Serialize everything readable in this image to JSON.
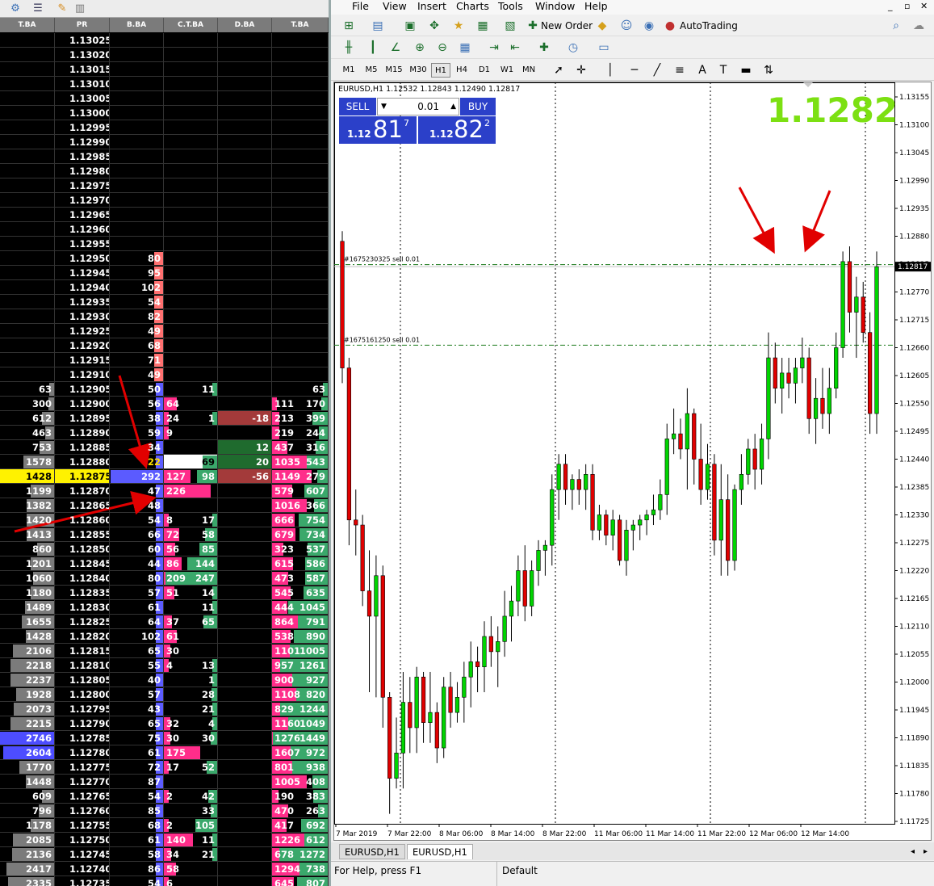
{
  "dom": {
    "toolbar_icons": [
      "gear-icon",
      "list-icon",
      "pencil-icon",
      "trash-icon"
    ],
    "columns": [
      "T.BA",
      "PR",
      "B.BA",
      "C.T.BA",
      "D.BA",
      "T.BA"
    ],
    "rows": [
      {
        "ta": "",
        "pr": "1.13025",
        "bb": "",
        "ctl": "",
        "ctr": "",
        "db": "",
        "tl": "",
        "tr": ""
      },
      {
        "ta": "",
        "pr": "1.13020",
        "bb": "",
        "ctl": "",
        "ctr": "",
        "db": "",
        "tl": "",
        "tr": ""
      },
      {
        "ta": "",
        "pr": "1.13015",
        "bb": "",
        "ctl": "",
        "ctr": "",
        "db": "",
        "tl": "",
        "tr": ""
      },
      {
        "ta": "",
        "pr": "1.13010",
        "bb": "",
        "ctl": "",
        "ctr": "",
        "db": "",
        "tl": "",
        "tr": ""
      },
      {
        "ta": "",
        "pr": "1.13005",
        "bb": "",
        "ctl": "",
        "ctr": "",
        "db": "",
        "tl": "",
        "tr": ""
      },
      {
        "ta": "",
        "pr": "1.13000",
        "bb": "",
        "ctl": "",
        "ctr": "",
        "db": "",
        "tl": "",
        "tr": ""
      },
      {
        "ta": "",
        "pr": "1.12995",
        "bb": "",
        "ctl": "",
        "ctr": "",
        "db": "",
        "tl": "",
        "tr": ""
      },
      {
        "ta": "",
        "pr": "1.12990",
        "bb": "",
        "ctl": "",
        "ctr": "",
        "db": "",
        "tl": "",
        "tr": ""
      },
      {
        "ta": "",
        "pr": "1.12985",
        "bb": "",
        "ctl": "",
        "ctr": "",
        "db": "",
        "tl": "",
        "tr": ""
      },
      {
        "ta": "",
        "pr": "1.12980",
        "bb": "",
        "ctl": "",
        "ctr": "",
        "db": "",
        "tl": "",
        "tr": ""
      },
      {
        "ta": "",
        "pr": "1.12975",
        "bb": "",
        "ctl": "",
        "ctr": "",
        "db": "",
        "tl": "",
        "tr": ""
      },
      {
        "ta": "",
        "pr": "1.12970",
        "bb": "",
        "ctl": "",
        "ctr": "",
        "db": "",
        "tl": "",
        "tr": ""
      },
      {
        "ta": "",
        "pr": "1.12965",
        "bb": "",
        "ctl": "",
        "ctr": "",
        "db": "",
        "tl": "",
        "tr": ""
      },
      {
        "ta": "",
        "pr": "1.12960",
        "bb": "",
        "ctl": "",
        "ctr": "",
        "db": "",
        "tl": "",
        "tr": ""
      },
      {
        "ta": "",
        "pr": "1.12955",
        "bb": "",
        "ctl": "",
        "ctr": "",
        "db": "",
        "tl": "",
        "tr": ""
      },
      {
        "ta": "",
        "pr": "1.12950",
        "bb": "80",
        "ctl": "",
        "ctr": "",
        "db": "",
        "tl": "",
        "tr": ""
      },
      {
        "ta": "",
        "pr": "1.12945",
        "bb": "95",
        "ctl": "",
        "ctr": "",
        "db": "",
        "tl": "",
        "tr": ""
      },
      {
        "ta": "",
        "pr": "1.12940",
        "bb": "102",
        "ctl": "",
        "ctr": "",
        "db": "",
        "tl": "",
        "tr": ""
      },
      {
        "ta": "",
        "pr": "1.12935",
        "bb": "54",
        "ctl": "",
        "ctr": "",
        "db": "",
        "tl": "",
        "tr": ""
      },
      {
        "ta": "",
        "pr": "1.12930",
        "bb": "82",
        "ctl": "",
        "ctr": "",
        "db": "",
        "tl": "",
        "tr": ""
      },
      {
        "ta": "",
        "pr": "1.12925",
        "bb": "49",
        "ctl": "",
        "ctr": "",
        "db": "",
        "tl": "",
        "tr": ""
      },
      {
        "ta": "",
        "pr": "1.12920",
        "bb": "68",
        "ctl": "",
        "ctr": "",
        "db": "",
        "tl": "",
        "tr": ""
      },
      {
        "ta": "",
        "pr": "1.12915",
        "bb": "71",
        "ctl": "",
        "ctr": "",
        "db": "",
        "tl": "",
        "tr": ""
      },
      {
        "ta": "",
        "pr": "1.12910",
        "bb": "49",
        "ctl": "",
        "ctr": "",
        "db": "",
        "tl": "",
        "tr": ""
      },
      {
        "ta": "63",
        "pr": "1.12905",
        "bb": "50",
        "ctl": "",
        "ctr": "11",
        "db": "",
        "tl": "",
        "tr": "63"
      },
      {
        "ta": "300",
        "pr": "1.12900",
        "bb": "56",
        "ctl": "64",
        "ctr": "",
        "db": "",
        "tl": "111",
        "tr": "170"
      },
      {
        "ta": "612",
        "pr": "1.12895",
        "bb": "38",
        "ctl": "24",
        "ctr": "1",
        "db": "-18",
        "tl": "213",
        "tr": "399"
      },
      {
        "ta": "463",
        "pr": "1.12890",
        "bb": "59",
        "ctl": "9",
        "ctr": "",
        "db": "",
        "tl": "219",
        "tr": "244"
      },
      {
        "ta": "753",
        "pr": "1.12885",
        "bb": "34",
        "ctl": "",
        "ctr": "",
        "db": "12",
        "tl": "437",
        "tr": "316"
      },
      {
        "ta": "1578",
        "pr": "1.12880",
        "bb": "22",
        "ctl": "",
        "ctr": "69",
        "db": "20",
        "tl": "1035",
        "tr": "543"
      },
      {
        "ta": "1428",
        "pr": "1.12875",
        "bb": "292",
        "ctl": "127",
        "ctr": "98",
        "db": "-56",
        "tl": "1149",
        "tr": "279"
      },
      {
        "ta": "1199",
        "pr": "1.12870",
        "bb": "47",
        "ctl": "226",
        "ctr": "",
        "db": "",
        "tl": "579",
        "tr": "607"
      },
      {
        "ta": "1382",
        "pr": "1.12865",
        "bb": "48",
        "ctl": "",
        "ctr": "",
        "db": "",
        "tl": "1016",
        "tr": "366"
      },
      {
        "ta": "1420",
        "pr": "1.12860",
        "bb": "54",
        "ctl": "8",
        "ctr": "17",
        "db": "",
        "tl": "666",
        "tr": "754"
      },
      {
        "ta": "1413",
        "pr": "1.12855",
        "bb": "66",
        "ctl": "72",
        "ctr": "58",
        "db": "",
        "tl": "679",
        "tr": "734"
      },
      {
        "ta": "860",
        "pr": "1.12850",
        "bb": "60",
        "ctl": "56",
        "ctr": "85",
        "db": "",
        "tl": "323",
        "tr": "537"
      },
      {
        "ta": "1201",
        "pr": "1.12845",
        "bb": "44",
        "ctl": "86",
        "ctr": "144",
        "db": "",
        "tl": "615",
        "tr": "586"
      },
      {
        "ta": "1060",
        "pr": "1.12840",
        "bb": "80",
        "ctl": "209",
        "ctr": "247",
        "db": "",
        "tl": "473",
        "tr": "587"
      },
      {
        "ta": "1180",
        "pr": "1.12835",
        "bb": "57",
        "ctl": "51",
        "ctr": "14",
        "db": "",
        "tl": "545",
        "tr": "635"
      },
      {
        "ta": "1489",
        "pr": "1.12830",
        "bb": "61",
        "ctl": "",
        "ctr": "11",
        "db": "",
        "tl": "444",
        "tr": "1045"
      },
      {
        "ta": "1655",
        "pr": "1.12825",
        "bb": "64",
        "ctl": "37",
        "ctr": "65",
        "db": "",
        "tl": "864",
        "tr": "791"
      },
      {
        "ta": "1428",
        "pr": "1.12820",
        "bb": "102",
        "ctl": "61",
        "ctr": "",
        "db": "",
        "tl": "538",
        "tr": "890"
      },
      {
        "ta": "2106",
        "pr": "1.12815",
        "bb": "65",
        "ctl": "30",
        "ctr": "",
        "db": "",
        "tl": "1101",
        "tr": "1005"
      },
      {
        "ta": "2218",
        "pr": "1.12810",
        "bb": "55",
        "ctl": "4",
        "ctr": "13",
        "db": "",
        "tl": "957",
        "tr": "1261"
      },
      {
        "ta": "2237",
        "pr": "1.12805",
        "bb": "40",
        "ctl": "",
        "ctr": "1",
        "db": "",
        "tl": "900",
        "tr": "927"
      },
      {
        "ta": "1928",
        "pr": "1.12800",
        "bb": "57",
        "ctl": "",
        "ctr": "28",
        "db": "",
        "tl": "1108",
        "tr": "820"
      },
      {
        "ta": "2073",
        "pr": "1.12795",
        "bb": "43",
        "ctl": "",
        "ctr": "21",
        "db": "",
        "tl": "829",
        "tr": "1244"
      },
      {
        "ta": "2215",
        "pr": "1.12790",
        "bb": "65",
        "ctl": "32",
        "ctr": "4",
        "db": "",
        "tl": "1160",
        "tr": "1049"
      },
      {
        "ta": "2746",
        "pr": "1.12785",
        "bb": "75",
        "ctl": "30",
        "ctr": "30",
        "db": "",
        "tl": "1276",
        "tr": "1449"
      },
      {
        "ta": "2604",
        "pr": "1.12780",
        "bb": "61",
        "ctl": "175",
        "ctr": "",
        "db": "",
        "tl": "1607",
        "tr": "972"
      },
      {
        "ta": "1770",
        "pr": "1.12775",
        "bb": "72",
        "ctl": "17",
        "ctr": "52",
        "db": "",
        "tl": "801",
        "tr": "938"
      },
      {
        "ta": "1448",
        "pr": "1.12770",
        "bb": "87",
        "ctl": "",
        "ctr": "",
        "db": "",
        "tl": "1005",
        "tr": "408"
      },
      {
        "ta": "609",
        "pr": "1.12765",
        "bb": "54",
        "ctl": "2",
        "ctr": "42",
        "db": "",
        "tl": "190",
        "tr": "383"
      },
      {
        "ta": "796",
        "pr": "1.12760",
        "bb": "85",
        "ctl": "",
        "ctr": "33",
        "db": "",
        "tl": "470",
        "tr": "263"
      },
      {
        "ta": "1178",
        "pr": "1.12755",
        "bb": "68",
        "ctl": "2",
        "ctr": "105",
        "db": "",
        "tl": "417",
        "tr": "692"
      },
      {
        "ta": "2085",
        "pr": "1.12750",
        "bb": "61",
        "ctl": "140",
        "ctr": "11",
        "db": "",
        "tl": "1226",
        "tr": "612"
      },
      {
        "ta": "2136",
        "pr": "1.12745",
        "bb": "58",
        "ctl": "34",
        "ctr": "21",
        "db": "",
        "tl": "678",
        "tr": "1272"
      },
      {
        "ta": "2417",
        "pr": "1.12740",
        "bb": "86",
        "ctl": "58",
        "ctr": "",
        "db": "",
        "tl": "1294",
        "tr": "738"
      },
      {
        "ta": "2335",
        "pr": "1.12735",
        "bb": "54",
        "ctl": "6",
        "ctr": "",
        "db": "",
        "tl": "645",
        "tr": "807"
      }
    ]
  },
  "mt": {
    "menu": [
      "File",
      "View",
      "Insert",
      "Charts",
      "Tools",
      "Window",
      "Help"
    ],
    "toolbar": {
      "new_order": "New Order",
      "autotrading": "AutoTrading"
    },
    "timeframes": [
      "M1",
      "M5",
      "M15",
      "M30",
      "H1",
      "H4",
      "D1",
      "W1",
      "MN"
    ],
    "active_timeframe": "H1",
    "chart": {
      "title": "EURUSD,H1  1.12532 1.12843 1.12490 1.12817",
      "big_price": "1.1282",
      "sell_label": "SELL",
      "buy_label": "BUY",
      "lot": "0.01",
      "sell_price_small": "1.12",
      "sell_price_big": "81",
      "sell_price_sup": "7",
      "buy_price_small": "1.12",
      "buy_price_big": "82",
      "buy_price_sup": "2",
      "current_price_label": "1.12817",
      "order_lines": [
        {
          "label": "#1675230325 sell 0.01",
          "price": 1.12824
        },
        {
          "label": "#1675161250 sell 0.01",
          "price": 1.12665
        }
      ]
    },
    "tabs": [
      "EURUSD,H1",
      "EURUSD,H1"
    ],
    "status": {
      "help": "For Help, press F1",
      "profile": "Default"
    }
  },
  "chart_data": {
    "type": "candlestick",
    "symbol": "EURUSD",
    "timeframe": "H1",
    "yticks": [
      1.13155,
      1.131,
      1.13045,
      1.1299,
      1.12935,
      1.1288,
      1.12825,
      1.1277,
      1.12715,
      1.1266,
      1.12605,
      1.1255,
      1.12495,
      1.1244,
      1.12385,
      1.1233,
      1.12275,
      1.1222,
      1.12165,
      1.1211,
      1.12055,
      1.12,
      1.11945,
      1.1189,
      1.11835,
      1.1178,
      1.11725
    ],
    "ylim": [
      1.11725,
      1.13155
    ],
    "xticks": [
      "7 Mar 2019",
      "7 Mar 22:00",
      "8 Mar 06:00",
      "8 Mar 14:00",
      "8 Mar 22:00",
      "11 Mar 06:00",
      "11 Mar 14:00",
      "11 Mar 22:00",
      "12 Mar 06:00",
      "12 Mar 14:00"
    ],
    "candles": [
      [
        1.1287,
        1.1289,
        1.1259,
        1.1262
      ],
      [
        1.1262,
        1.1264,
        1.1227,
        1.1232
      ],
      [
        1.1232,
        1.1238,
        1.1225,
        1.1231
      ],
      [
        1.1231,
        1.1233,
        1.1215,
        1.1218
      ],
      [
        1.1218,
        1.1226,
        1.1198,
        1.1213
      ],
      [
        1.1213,
        1.1225,
        1.1197,
        1.1221
      ],
      [
        1.1221,
        1.1223,
        1.1191,
        1.1197
      ],
      [
        1.1197,
        1.1198,
        1.1174,
        1.1181
      ],
      [
        1.1181,
        1.1193,
        1.1179,
        1.1186
      ],
      [
        1.1186,
        1.1202,
        1.1179,
        1.1196
      ],
      [
        1.1196,
        1.1201,
        1.1186,
        1.1191
      ],
      [
        1.1191,
        1.1203,
        1.1186,
        1.1201
      ],
      [
        1.1201,
        1.1202,
        1.1188,
        1.1192
      ],
      [
        1.1192,
        1.1202,
        1.1188,
        1.1194
      ],
      [
        1.1194,
        1.1196,
        1.1184,
        1.1187
      ],
      [
        1.1187,
        1.1201,
        1.1185,
        1.1199
      ],
      [
        1.1199,
        1.1202,
        1.1191,
        1.1194
      ],
      [
        1.1194,
        1.12,
        1.1192,
        1.1197
      ],
      [
        1.1197,
        1.1204,
        1.1192,
        1.1201
      ],
      [
        1.1201,
        1.1208,
        1.1195,
        1.1204
      ],
      [
        1.1204,
        1.1207,
        1.1198,
        1.1203
      ],
      [
        1.1203,
        1.1212,
        1.1198,
        1.1209
      ],
      [
        1.1209,
        1.1213,
        1.1203,
        1.1206
      ],
      [
        1.1206,
        1.1211,
        1.1199,
        1.1208
      ],
      [
        1.1208,
        1.1218,
        1.1205,
        1.1213
      ],
      [
        1.1213,
        1.1219,
        1.1208,
        1.1216
      ],
      [
        1.1216,
        1.1225,
        1.1213,
        1.1222
      ],
      [
        1.1222,
        1.1227,
        1.1212,
        1.1215
      ],
      [
        1.1215,
        1.1224,
        1.1213,
        1.1222
      ],
      [
        1.1222,
        1.1228,
        1.1219,
        1.1226
      ],
      [
        1.1226,
        1.1228,
        1.1221,
        1.1227
      ],
      [
        1.1227,
        1.1241,
        1.1223,
        1.1238
      ],
      [
        1.1238,
        1.1245,
        1.1232,
        1.1243
      ],
      [
        1.1243,
        1.1245,
        1.1235,
        1.1238
      ],
      [
        1.1238,
        1.1241,
        1.1234,
        1.124
      ],
      [
        1.124,
        1.1242,
        1.1235,
        1.1238
      ],
      [
        1.1238,
        1.1243,
        1.1234,
        1.1241
      ],
      [
        1.1241,
        1.1243,
        1.1228,
        1.123
      ],
      [
        1.123,
        1.1235,
        1.1228,
        1.1233
      ],
      [
        1.1233,
        1.1234,
        1.1227,
        1.1229
      ],
      [
        1.1229,
        1.1234,
        1.1226,
        1.1232
      ],
      [
        1.1232,
        1.1233,
        1.1223,
        1.1224
      ],
      [
        1.1224,
        1.1232,
        1.1221,
        1.123
      ],
      [
        1.123,
        1.1232,
        1.1226,
        1.1231
      ],
      [
        1.1231,
        1.1233,
        1.1228,
        1.1232
      ],
      [
        1.1232,
        1.1234,
        1.1229,
        1.1233
      ],
      [
        1.1233,
        1.1237,
        1.1231,
        1.1234
      ],
      [
        1.1234,
        1.124,
        1.1232,
        1.1237
      ],
      [
        1.1237,
        1.1251,
        1.1233,
        1.1248
      ],
      [
        1.1248,
        1.1254,
        1.1245,
        1.1249
      ],
      [
        1.1249,
        1.1252,
        1.1244,
        1.1246
      ],
      [
        1.1246,
        1.1258,
        1.1238,
        1.1253
      ],
      [
        1.1253,
        1.1254,
        1.1239,
        1.1244
      ],
      [
        1.1244,
        1.1251,
        1.1235,
        1.1238
      ],
      [
        1.1238,
        1.1247,
        1.1236,
        1.1243
      ],
      [
        1.1243,
        1.1245,
        1.1225,
        1.1228
      ],
      [
        1.1228,
        1.1243,
        1.1221,
        1.1236
      ],
      [
        1.1236,
        1.1241,
        1.1221,
        1.1224
      ],
      [
        1.1224,
        1.1239,
        1.1222,
        1.1238
      ],
      [
        1.1238,
        1.1245,
        1.1235,
        1.1241
      ],
      [
        1.1241,
        1.1248,
        1.1239,
        1.1246
      ],
      [
        1.1246,
        1.1249,
        1.1238,
        1.1242
      ],
      [
        1.1242,
        1.1251,
        1.1239,
        1.1248
      ],
      [
        1.1248,
        1.1269,
        1.1244,
        1.1264
      ],
      [
        1.1264,
        1.1267,
        1.1255,
        1.1258
      ],
      [
        1.1258,
        1.1264,
        1.1253,
        1.1261
      ],
      [
        1.1261,
        1.1264,
        1.1256,
        1.1259
      ],
      [
        1.1259,
        1.1264,
        1.1255,
        1.1262
      ],
      [
        1.1262,
        1.1268,
        1.1259,
        1.1264
      ],
      [
        1.1264,
        1.1266,
        1.1249,
        1.1252
      ],
      [
        1.1252,
        1.126,
        1.1247,
        1.1256
      ],
      [
        1.1256,
        1.1262,
        1.125,
        1.1253
      ],
      [
        1.1253,
        1.1262,
        1.1249,
        1.1258
      ],
      [
        1.1258,
        1.1269,
        1.1256,
        1.1266
      ],
      [
        1.1266,
        1.1285,
        1.1264,
        1.1283
      ],
      [
        1.1283,
        1.1286,
        1.1269,
        1.1273
      ],
      [
        1.1273,
        1.128,
        1.1264,
        1.1276
      ],
      [
        1.1276,
        1.1279,
        1.1267,
        1.1269
      ],
      [
        1.1269,
        1.1273,
        1.1249,
        1.1253
      ],
      [
        1.1253,
        1.1285,
        1.1249,
        1.1282
      ]
    ]
  }
}
